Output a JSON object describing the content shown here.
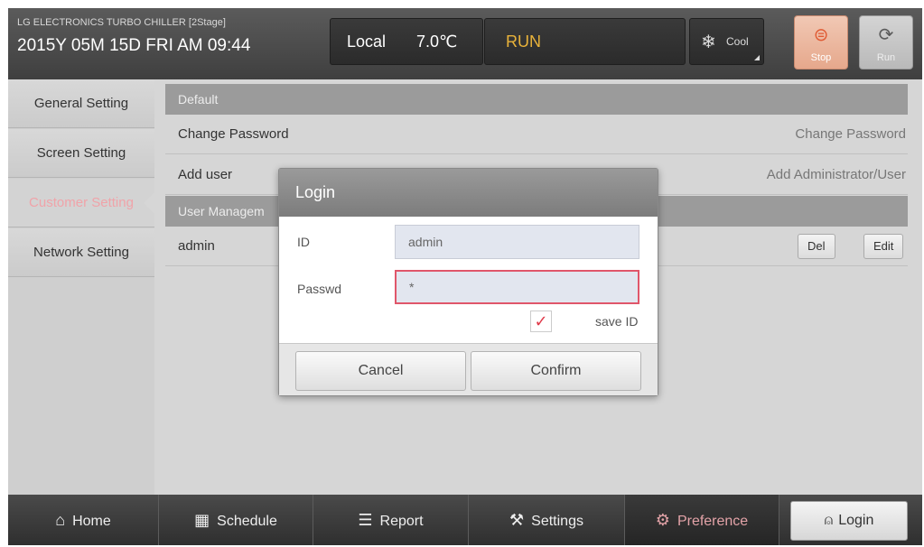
{
  "header": {
    "brand": "LG ELECTRONICS TURBO CHILLER [2Stage]",
    "datetime": "2015Y 05M 15D  FRI AM 09:44",
    "mode": "Local",
    "temperature": "7.0℃",
    "status": "RUN",
    "cool_label": "Cool",
    "cool_icon": "snowflake-icon",
    "stop_label": "Stop",
    "run_label": "Run"
  },
  "sidebar": {
    "items": [
      {
        "label": "General Setting",
        "active": false
      },
      {
        "label": "Screen Setting",
        "active": false
      },
      {
        "label": "Customer Setting",
        "active": true
      },
      {
        "label": "Network Setting",
        "active": false
      }
    ]
  },
  "main": {
    "default_header": "Default",
    "change_password": {
      "label": "Change Password",
      "value": "Change Password"
    },
    "add_user": {
      "label": "Add user",
      "value": "Add Administrator/User"
    },
    "user_mgmt_header": "User Managem",
    "user_row": {
      "name": "admin",
      "del_label": "Del",
      "edit_label": "Edit"
    }
  },
  "dialog": {
    "title": "Login",
    "id_label": "ID",
    "id_value": "admin",
    "passwd_label": "Passwd",
    "passwd_value": "*",
    "save_id_checked": true,
    "save_id_label": "save ID",
    "cancel_label": "Cancel",
    "confirm_label": "Confirm"
  },
  "footer": {
    "tabs": [
      {
        "label": "Home",
        "icon": "home-icon"
      },
      {
        "label": "Schedule",
        "icon": "calendar-icon"
      },
      {
        "label": "Report",
        "icon": "list-icon"
      },
      {
        "label": "Settings",
        "icon": "tools-icon"
      },
      {
        "label": "Preference",
        "icon": "gear-icon",
        "active": true
      }
    ],
    "login_label": "Login",
    "login_icon": "user-icon"
  },
  "colors": {
    "accent_pink": "#e3a3a8",
    "run_yellow": "#e8b23a",
    "stop_orange": "#e05b34",
    "focus_red": "#e0566a"
  }
}
